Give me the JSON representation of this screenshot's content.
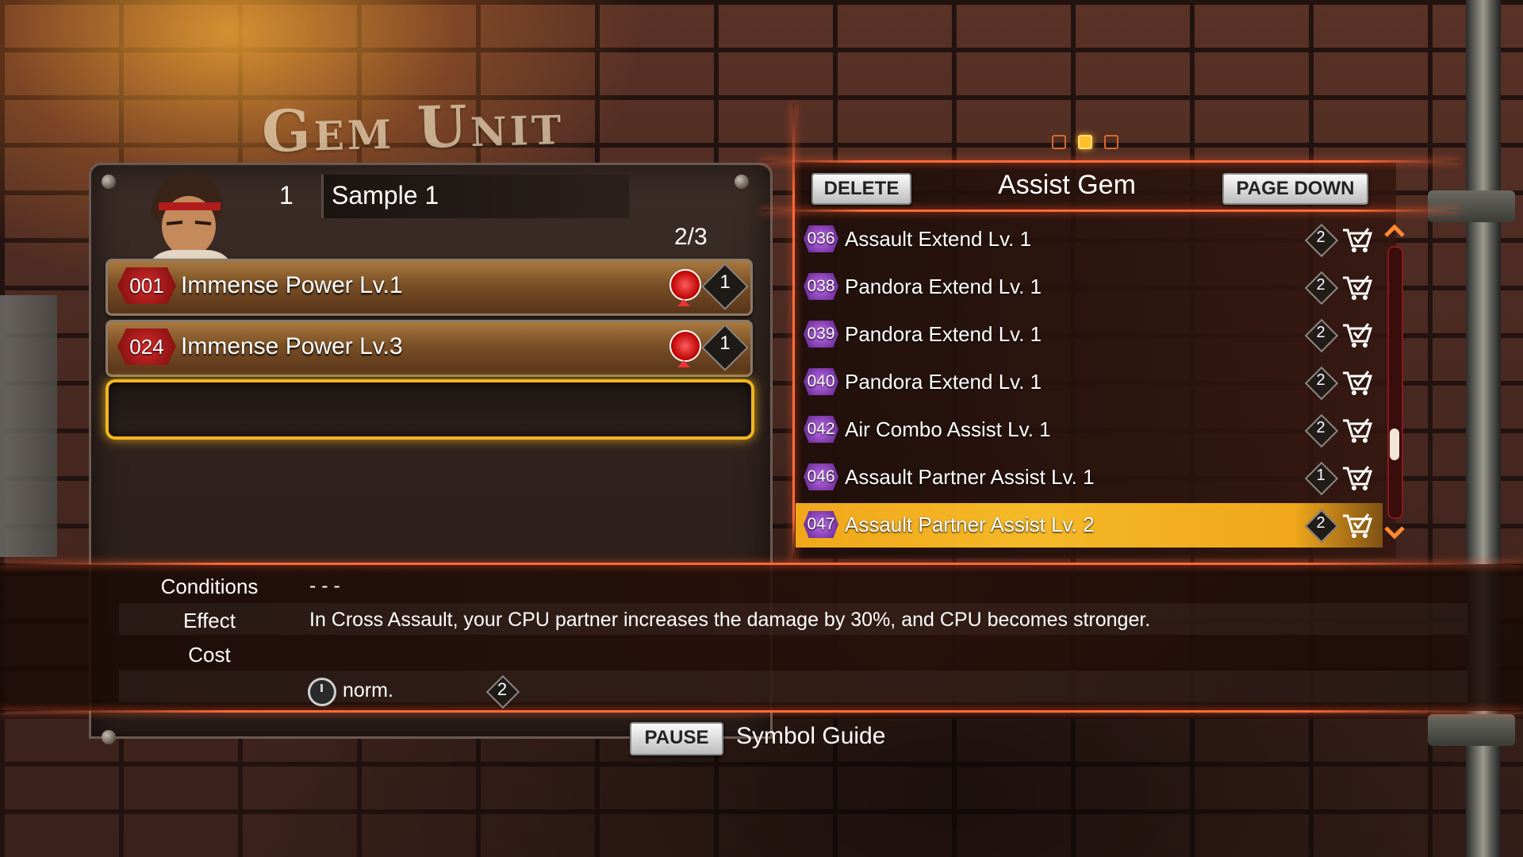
{
  "header": {
    "title": "Gem Unit"
  },
  "unit": {
    "slot_number": "1",
    "name": "Sample 1",
    "capacity": "2/3",
    "equipped": [
      {
        "number": "001",
        "label": "Immense Power Lv.1",
        "cost": "1"
      },
      {
        "number": "024",
        "label": "Immense Power Lv.3",
        "cost": "1"
      }
    ]
  },
  "pager": {
    "pages": 3,
    "current": 2
  },
  "list": {
    "title": "Assist Gem",
    "delete_label": "DELETE",
    "page_down_label": "PAGE DOWN",
    "items": [
      {
        "number": "036",
        "label": "Assault Extend Lv. 1",
        "cost": "2"
      },
      {
        "number": "038",
        "label": "Pandora Extend Lv. 1",
        "cost": "2"
      },
      {
        "number": "039",
        "label": "Pandora Extend Lv. 1",
        "cost": "2"
      },
      {
        "number": "040",
        "label": "Pandora Extend Lv. 1",
        "cost": "2"
      },
      {
        "number": "042",
        "label": "Air Combo Assist Lv. 1",
        "cost": "2"
      },
      {
        "number": "046",
        "label": "Assault Partner Assist Lv. 1",
        "cost": "1"
      },
      {
        "number": "047",
        "label": "Assault Partner Assist Lv. 2",
        "cost": "2",
        "selected": true
      }
    ]
  },
  "details": {
    "conditions_label": "Conditions",
    "conditions_value": "- - -",
    "effect_label": "Effect",
    "effect_value": "In Cross Assault, your CPU partner increases the damage by 30%, and CPU becomes stronger.",
    "cost_label": "Cost",
    "speed_value": "norm.",
    "cost_value": "2"
  },
  "footer": {
    "pause_label": "PAUSE",
    "symbol_guide_label": "Symbol Guide"
  },
  "colors": {
    "accent_orange": "#ff6a3a",
    "selection_gold": "#f5b928",
    "gem_red": "#d22a2a",
    "gem_purple": "#c06ef0"
  }
}
